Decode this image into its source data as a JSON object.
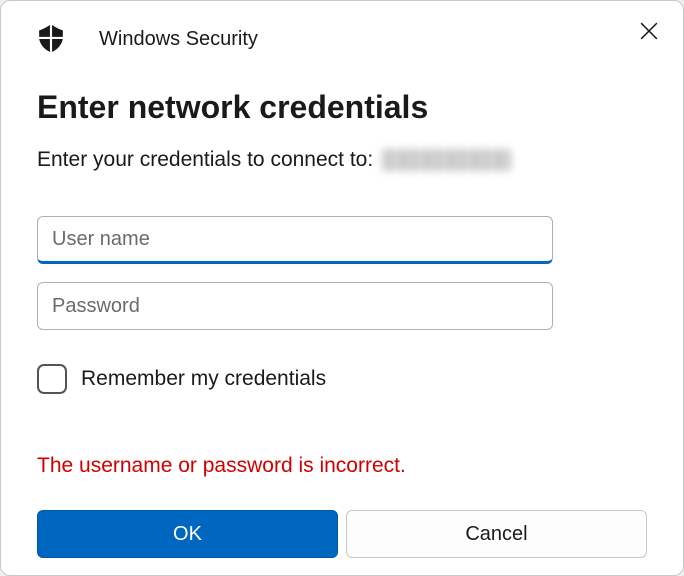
{
  "titlebar": {
    "app_name": "Windows Security"
  },
  "dialog": {
    "heading": "Enter network credentials",
    "prompt_prefix": "Enter your credentials to connect to:"
  },
  "fields": {
    "username_placeholder": "User name",
    "username_value": "",
    "password_placeholder": "Password",
    "password_value": ""
  },
  "remember": {
    "label": "Remember my credentials",
    "checked": false
  },
  "error": {
    "message": "The username or password is incorrect."
  },
  "buttons": {
    "ok": "OK",
    "cancel": "Cancel"
  }
}
